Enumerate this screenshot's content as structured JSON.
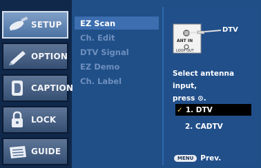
{
  "sidebar": {
    "items": [
      {
        "label": "SETUP",
        "icon": "satellite-icon"
      },
      {
        "label": "OPTION",
        "icon": "pen-icon"
      },
      {
        "label": "CAPTION",
        "icon": "caption-icon"
      },
      {
        "label": "LOCK",
        "icon": "lock-icon"
      },
      {
        "label": "GUIDE",
        "icon": "guide-icon"
      }
    ]
  },
  "submenu": {
    "items": [
      {
        "label": "EZ Scan"
      },
      {
        "label": "Ch. Edit"
      },
      {
        "label": "DTV Signal"
      },
      {
        "label": "EZ Demo"
      },
      {
        "label": "Ch. Label"
      }
    ]
  },
  "panel": {
    "diagram": {
      "ant_in_label": "ANT IN",
      "loop_out_label": "LOOP OUT",
      "dtv_label": "DTV"
    },
    "prompt_line1": "Select antenna input,",
    "prompt_line2": "press ⊙.",
    "options": [
      {
        "label": "1. DTV"
      },
      {
        "label": "2. CADTV"
      }
    ],
    "check_symbol": "✓",
    "menu_key_label": "MENU",
    "prev_label": "Prev."
  },
  "colors": {
    "background": "#1f4f86",
    "sidebar_bg": "#10284a",
    "submenu_selected": "#3c6eb0",
    "submenu_dim": "#6f8fbf",
    "option_selected_bg": "#000000",
    "check": "#ffd34a"
  }
}
